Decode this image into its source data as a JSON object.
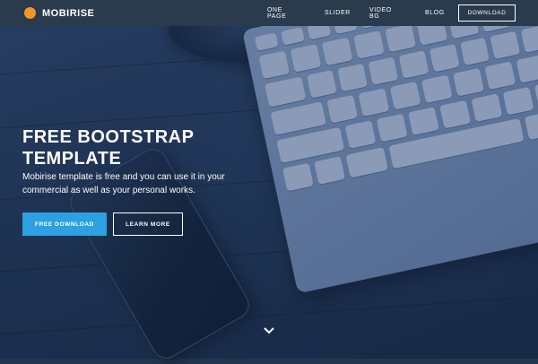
{
  "navbar": {
    "brand": "MOBIRISE",
    "logo_color": "#f39426",
    "menu": [
      "ONE PAGE",
      "SLIDER",
      "VIDEO BG",
      "BLOG"
    ],
    "cta": "DOWNLOAD"
  },
  "hero": {
    "title_line1": "FREE BOOTSTRAP",
    "title_line2": "TEMPLATE",
    "subtitle_line1": "Mobirise template is free and you can use it in your",
    "subtitle_line2": "commercial as well as your personal works.",
    "primary_button": "FREE DOWNLOAD",
    "secondary_button": "LEARN MORE",
    "primary_color": "#2ca0e0",
    "scroll_icon": "chevron-down-icon"
  }
}
